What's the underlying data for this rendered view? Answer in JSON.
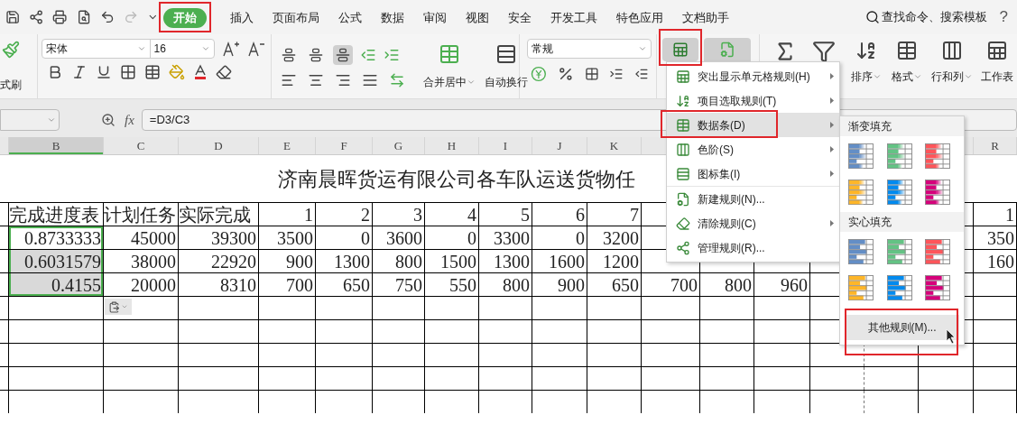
{
  "tabs": [
    {
      "label": "开始",
      "selected": true,
      "highlighted": true
    },
    {
      "label": "插入",
      "selected": false,
      "highlighted": false
    },
    {
      "label": "页面布局",
      "selected": false,
      "highlighted": false
    },
    {
      "label": "公式",
      "selected": false,
      "highlighted": false
    },
    {
      "label": "数据",
      "selected": false,
      "highlighted": false
    },
    {
      "label": "审阅",
      "selected": false,
      "highlighted": false
    },
    {
      "label": "视图",
      "selected": false,
      "highlighted": false
    },
    {
      "label": "安全",
      "selected": false,
      "highlighted": false
    },
    {
      "label": "开发工具",
      "selected": false,
      "highlighted": false
    },
    {
      "label": "特色应用",
      "selected": false,
      "highlighted": false
    },
    {
      "label": "文档助手",
      "selected": false,
      "highlighted": false
    }
  ],
  "search": {
    "placeholder": "查找命令、搜索模板"
  },
  "help": "?",
  "ribbon": {
    "format_painter": "式刷",
    "font": "宋体",
    "font_size": "16",
    "vertical_align": [
      {
        "on": false
      },
      {
        "on": false
      },
      {
        "on": true
      }
    ],
    "merge": "合并居中",
    "wrap": "自动换行",
    "number_format": "常规",
    "conditional_format_highlighted": true,
    "sort": "排序",
    "format": "格式",
    "rows_cols": "行和列",
    "sheet": "工作表"
  },
  "formula_bar": {
    "function_label": "fx",
    "formula": "=D3/C3"
  },
  "sheet": {
    "column_headers": {
      "left": [
        {
          "label": "B",
          "selected": true
        },
        {
          "label": "C",
          "selected": false
        },
        {
          "label": "D",
          "selected": false
        },
        {
          "label": "E",
          "selected": false
        },
        {
          "label": "F",
          "selected": false
        },
        {
          "label": "G",
          "selected": false
        },
        {
          "label": "H",
          "selected": false
        },
        {
          "label": "I",
          "selected": false
        },
        {
          "label": "J",
          "selected": false
        },
        {
          "label": "K",
          "selected": false
        }
      ],
      "right": [
        {
          "label": "R",
          "selected": false
        }
      ]
    },
    "title": "济南晨晖货运有限公司各车队运送货物任",
    "rows": [
      {
        "first": {
          "text": "完成进度表",
          "selected": false
        },
        "cells": [
          "计划任务",
          "实际完成",
          "1",
          "2",
          "3",
          "4",
          "5",
          "6",
          "7"
        ],
        "right_cells": [
          "1"
        ]
      },
      {
        "first": {
          "text": "0.8733333",
          "selected": true
        },
        "cells": [
          "45000",
          "39300",
          "3500",
          "0",
          "3600",
          "0",
          "3300",
          "0",
          "3200"
        ],
        "right_cells": [
          "350"
        ]
      },
      {
        "first": {
          "text": "0.6031579",
          "selected": true
        },
        "cells": [
          "38000",
          "22920",
          "900",
          "1300",
          "800",
          "1500",
          "1300",
          "1600",
          "1200"
        ],
        "right_cells": [
          "160"
        ]
      },
      {
        "first": {
          "text": "0.4155",
          "selected": true
        },
        "cells": [
          "20000",
          "8310",
          "700",
          "650",
          "750",
          "550",
          "800",
          "900",
          "650",
          "700",
          "800",
          "960"
        ]
      }
    ]
  },
  "menu": {
    "groups": [
      [
        {
          "label": "突出显示单元格规则(H)",
          "submenu": true,
          "hovered": false,
          "highlighted": false
        },
        {
          "label": "项目选取规则(T)",
          "submenu": true,
          "hovered": false,
          "highlighted": false
        },
        {
          "label": "数据条(D)",
          "submenu": true,
          "hovered": true,
          "highlighted": true
        },
        {
          "label": "色阶(S)",
          "submenu": true,
          "hovered": false,
          "highlighted": false
        },
        {
          "label": "图标集(I)",
          "submenu": true,
          "hovered": false,
          "highlighted": false
        }
      ],
      [
        {
          "label": "新建规则(N)...",
          "submenu": false,
          "hovered": false,
          "highlighted": false
        },
        {
          "label": "清除规则(C)",
          "submenu": true,
          "hovered": false,
          "highlighted": false
        },
        {
          "label": "管理规则(R)...",
          "submenu": false,
          "hovered": false,
          "highlighted": false
        }
      ]
    ]
  },
  "submenu": {
    "sections": [
      {
        "title": "渐变填充",
        "kind": "gradient",
        "swatches": [
          {
            "color": "#638ec6"
          },
          {
            "color": "#63c384"
          },
          {
            "color": "#ff555a"
          },
          {
            "color": "#ffb628"
          },
          {
            "color": "#008aef"
          },
          {
            "color": "#d6007b"
          }
        ]
      },
      {
        "title": "实心填充",
        "kind": "solid",
        "swatches": [
          {
            "color": "#638ec6"
          },
          {
            "color": "#63c384"
          },
          {
            "color": "#ff555a"
          },
          {
            "color": "#ffb628"
          },
          {
            "color": "#008aef"
          },
          {
            "color": "#d6007b"
          }
        ]
      }
    ],
    "more": {
      "label": "其他规则(M)...",
      "highlighted": true
    }
  }
}
